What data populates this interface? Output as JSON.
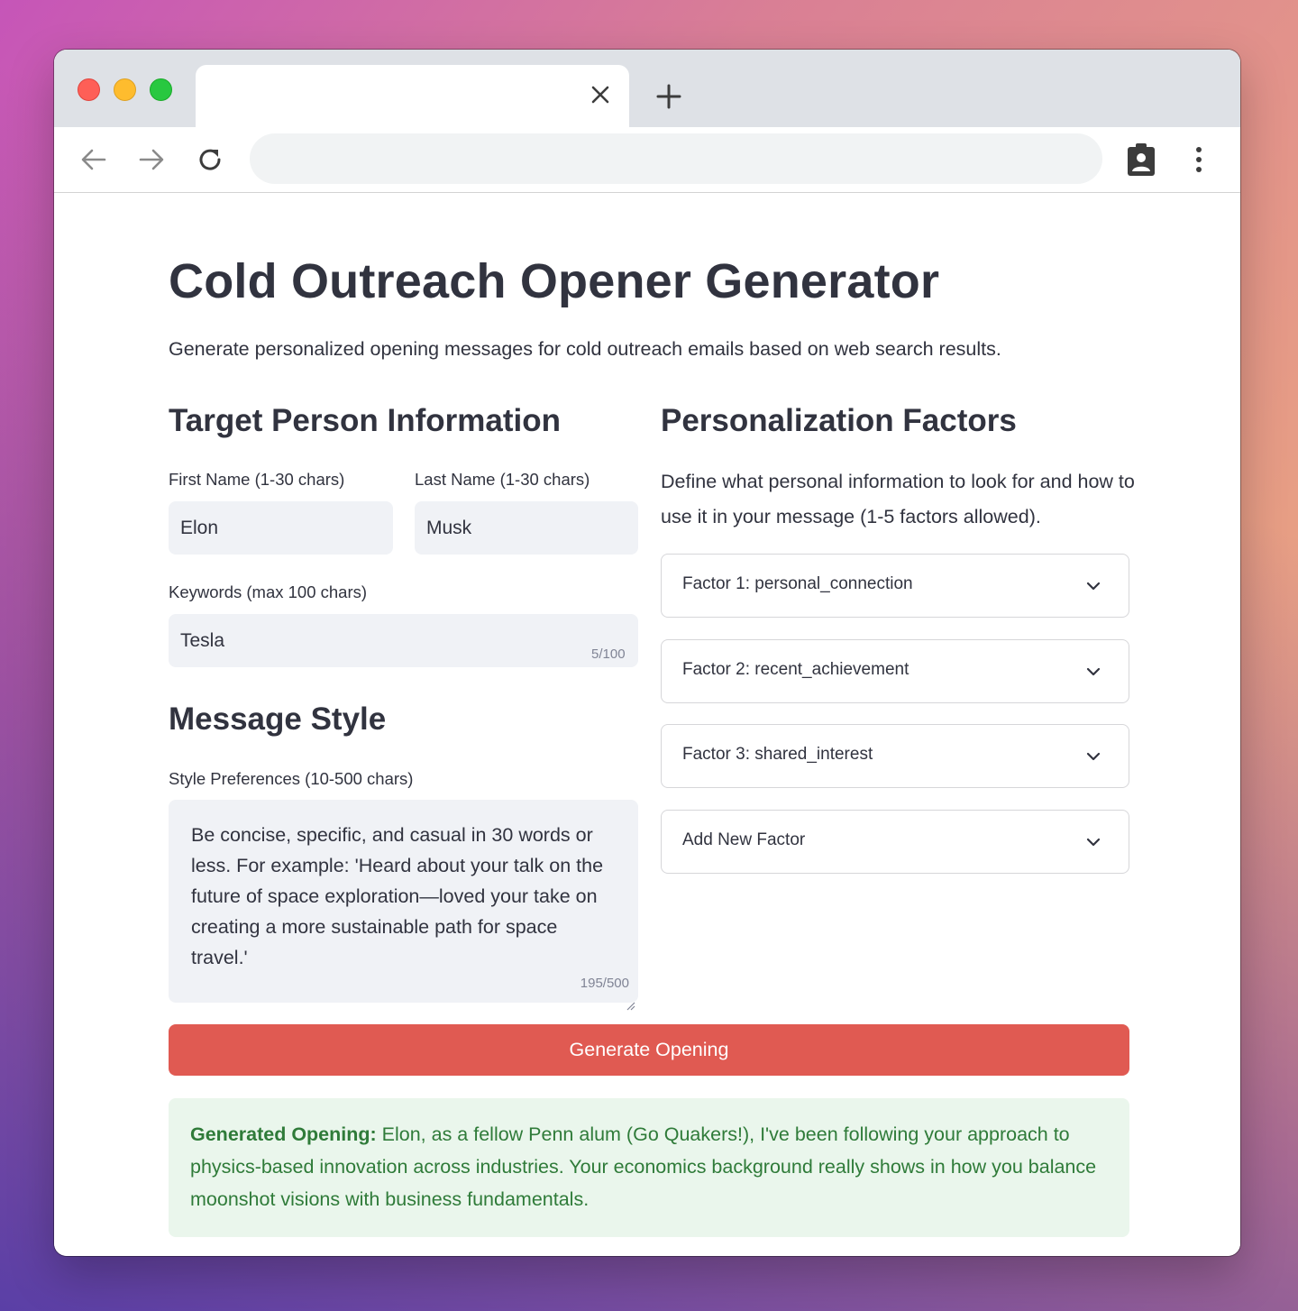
{
  "browser": {
    "tab_close_glyph": "✕",
    "new_tab_glyph": "+",
    "address_value": ""
  },
  "page": {
    "title": "Cold Outreach Opener Generator",
    "subtitle": "Generate personalized opening messages for cold outreach emails based on web search results."
  },
  "target": {
    "heading": "Target Person Information",
    "first_name_label": "First Name (1-30 chars)",
    "first_name_value": "Elon",
    "last_name_label": "Last Name (1-30 chars)",
    "last_name_value": "Musk",
    "keywords_label": "Keywords (max 100 chars)",
    "keywords_value": "Tesla",
    "keywords_counter": "5/100"
  },
  "style": {
    "heading": "Message Style",
    "label": "Style Preferences (10-500 chars)",
    "value": "Be concise, specific, and casual in 30 words or less. For example: 'Heard about your talk on the future of space exploration—loved your take on creating a more sustainable path for space travel.'",
    "counter": "195/500"
  },
  "factors": {
    "heading": "Personalization Factors",
    "description": "Define what personal information to look for and how to use it in your message (1-5 factors allowed).",
    "items": [
      {
        "label": "Factor 1: personal_connection"
      },
      {
        "label": "Factor 2: recent_achievement"
      },
      {
        "label": "Factor 3: shared_interest"
      },
      {
        "label": "Add New Factor"
      }
    ]
  },
  "actions": {
    "generate_label": "Generate Opening"
  },
  "result": {
    "label": "Generated Opening:",
    "text": " Elon, as a fellow Penn alum (Go Quakers!), I've been following your approach to physics-based innovation across industries. Your economics background really shows in how you balance moonshot visions with business fundamentals."
  },
  "colors": {
    "primary_button": "#e05a52",
    "success_bg": "#eaf6ec",
    "success_text": "#2f7b39"
  }
}
